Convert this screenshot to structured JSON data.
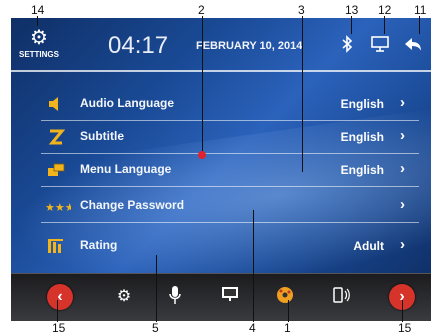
{
  "callouts": {
    "c14": "14",
    "c2": "2",
    "c3": "3",
    "c13": "13",
    "c12": "12",
    "c11": "11",
    "c15l": "15",
    "c5": "5",
    "c4": "4",
    "c1": "1",
    "c15r": "15"
  },
  "header": {
    "settings_label": "SETTINGS",
    "time": "04:17",
    "date": "FEBRUARY 10, 2014"
  },
  "settings_rows": [
    {
      "label": "Audio Language",
      "value": "English",
      "icon": "speaker-icon"
    },
    {
      "label": "Subtitle",
      "value": "English",
      "icon": "subtitle-icon"
    },
    {
      "label": "Menu Language",
      "value": "English",
      "icon": "menu-language-icon"
    },
    {
      "label": "Change Password",
      "value": "",
      "icon": "password-stars-icon"
    },
    {
      "label": "Rating",
      "value": "Adult",
      "icon": "rating-bars-icon"
    }
  ],
  "bottom_nav": {
    "icons": [
      "gear-icon",
      "microphone-icon",
      "display-icon",
      "disc-icon",
      "phone-icon"
    ]
  },
  "colors": {
    "accent_red": "#d6332b",
    "background_blue": "#1a4a96"
  }
}
